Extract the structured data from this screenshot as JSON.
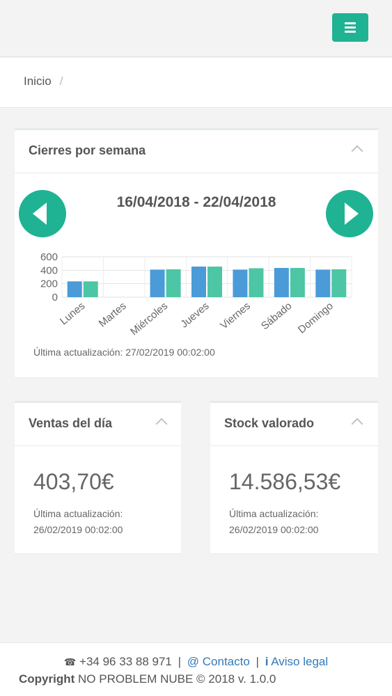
{
  "header": {
    "menu_icon": "hamburger-icon",
    "accent_color": "#1fb394"
  },
  "breadcrumb": {
    "home": "Inicio",
    "separator": "/"
  },
  "weekly": {
    "title": "Cierres por semana",
    "date_range": "16/04/2018 - 22/04/2018",
    "prev_icon": "chevron-left-icon",
    "next_icon": "chevron-right-icon",
    "updated": "Última actualización: 27/02/2019 00:02:00"
  },
  "chart_data": {
    "type": "bar",
    "categories": [
      "Lunes",
      "Martes",
      "Miércoles",
      "Jueves",
      "Viernes",
      "Sábado",
      "Domingo"
    ],
    "series": [
      {
        "values": [
          235,
          0,
          410,
          455,
          410,
          435,
          410
        ],
        "color": "#4a9bd8"
      },
      {
        "values": [
          235,
          0,
          415,
          455,
          430,
          435,
          415
        ],
        "color": "#4dc6a5"
      }
    ],
    "yticks": [
      0,
      200,
      400,
      600
    ],
    "ylim": [
      0,
      600
    ],
    "grid": true
  },
  "ventas": {
    "title": "Ventas del día",
    "value": "403,70€",
    "updated_label": "Última actualización:",
    "updated_time": "26/02/2019 00:02:00"
  },
  "stock": {
    "title": "Stock valorado",
    "value": "14.586,53€",
    "updated_label": "Última actualización:",
    "updated_time": "26/02/2019 00:02:00"
  },
  "footer": {
    "phone_icon": "phone-icon",
    "phone": "+34 96 33 88 971",
    "sep": "|",
    "contact_symbol": "@",
    "contact": "Contacto",
    "legal_symbol": "i",
    "legal": "Aviso legal",
    "copyright_label": "Copyright",
    "copyright_text": "NO PROBLEM NUBE © 2018 v. 1.0.0"
  }
}
